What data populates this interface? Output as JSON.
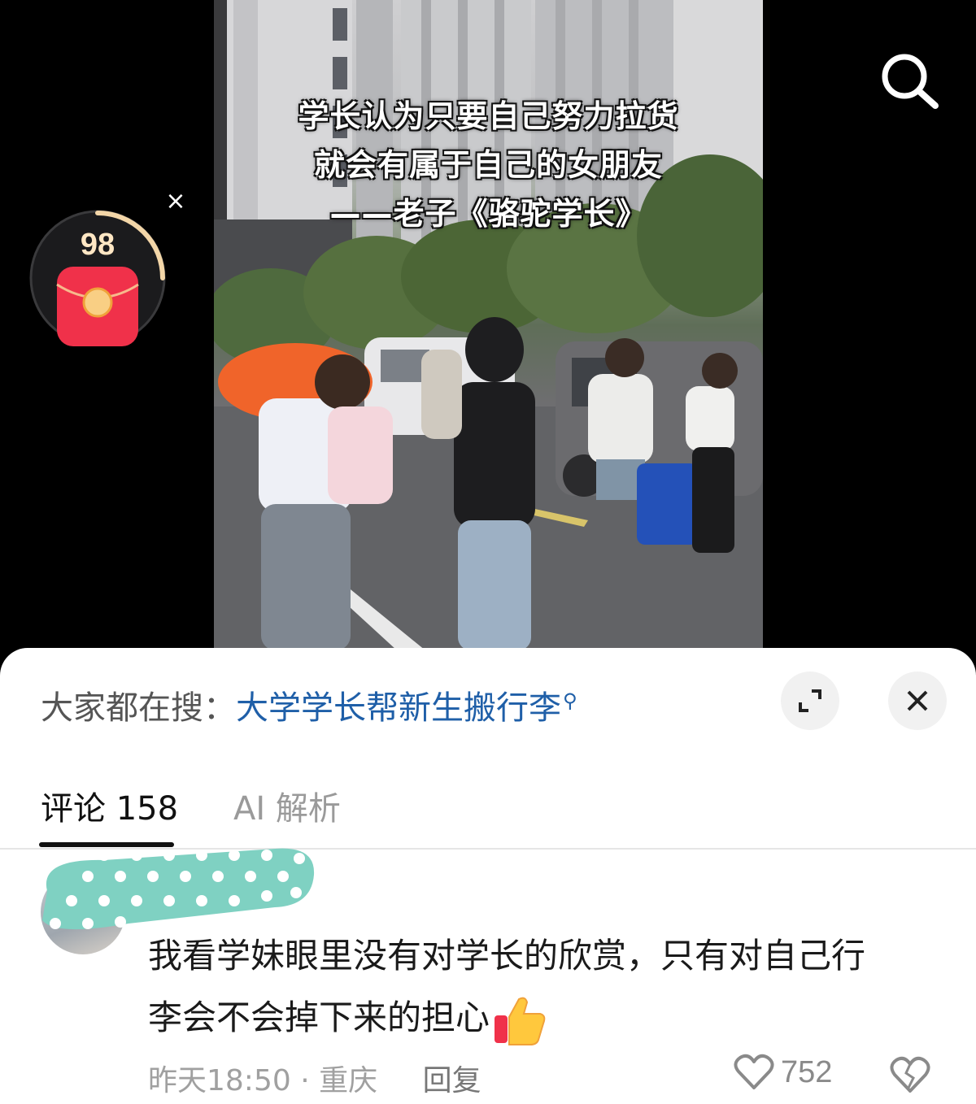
{
  "video": {
    "caption_lines": [
      "学长认为只要自己努力拉货",
      "就会有属于自己的女朋友",
      "——老子《骆驼学长》"
    ]
  },
  "overlay": {
    "timer_count": "98",
    "timer_progress": 0.25,
    "timer_close_label": "×"
  },
  "sheet": {
    "search_prefix": "大家都在搜：",
    "search_hint": "大学学长帮新生搬行李"
  },
  "tabs": [
    {
      "label": "评论 158",
      "active": true
    },
    {
      "label": "AI 解析",
      "active": false
    }
  ],
  "comment": {
    "line1": "我看学妹眼里没有对学长的欣赏，只有对自己行",
    "line2": "李会不会掉下来的担心",
    "time": "昨天18:50",
    "separator": "·",
    "location": "重庆",
    "reply_label": "回复",
    "likes": "752"
  },
  "icons": {
    "search": "search-icon",
    "expand": "expand-icon",
    "close": "close-icon",
    "red_packet": "red-packet-icon",
    "thumbs_up": "thumbs-up-emoji",
    "heart": "heart-icon",
    "dislike": "broken-heart-icon"
  },
  "colors": {
    "link_blue": "#1f5fa8",
    "red_packet": "#f0314a",
    "timer_ring": "#f3d6a8",
    "mask_teal": "#7fd1c2"
  }
}
